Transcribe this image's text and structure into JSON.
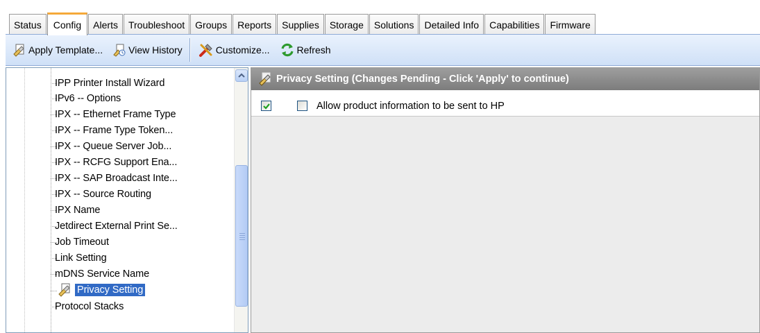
{
  "tabs": [
    {
      "label": "Status",
      "active": false
    },
    {
      "label": "Config",
      "active": true
    },
    {
      "label": "Alerts",
      "active": false
    },
    {
      "label": "Troubleshoot",
      "active": false
    },
    {
      "label": "Groups",
      "active": false
    },
    {
      "label": "Reports",
      "active": false
    },
    {
      "label": "Supplies",
      "active": false
    },
    {
      "label": "Storage",
      "active": false
    },
    {
      "label": "Solutions",
      "active": false
    },
    {
      "label": "Detailed Info",
      "active": false
    },
    {
      "label": "Capabilities",
      "active": false
    },
    {
      "label": "Firmware",
      "active": false
    }
  ],
  "toolbar": {
    "apply_template": "Apply Template...",
    "view_history": "View History",
    "customize": "Customize...",
    "refresh": "Refresh"
  },
  "tree": {
    "items": [
      "IPP Printer Install Wizard",
      "IPv6 -- Options",
      "IPX -- Ethernet Frame Type",
      "IPX -- Frame Type Token...",
      "IPX -- Queue Server Job...",
      "IPX -- RCFG Support Ena...",
      "IPX -- SAP Broadcast Inte...",
      "IPX -- Source Routing",
      "IPX Name",
      "Jetdirect External Print Se...",
      "Job Timeout",
      "Link Setting",
      "mDNS Service Name",
      "Privacy Setting",
      "Protocol Stacks"
    ],
    "selected": "Privacy Setting"
  },
  "content": {
    "header": "Privacy Setting (Changes Pending - Click 'Apply' to continue)",
    "option_label": "Allow product information to be sent to HP",
    "apply_checked": true,
    "option_checked": false
  },
  "colors": {
    "active_tab_accent": "#f5a93a",
    "selection": "#316ac5",
    "header_gray": "#8a8a8a",
    "toolbar_blue": "#cfe0f7"
  }
}
